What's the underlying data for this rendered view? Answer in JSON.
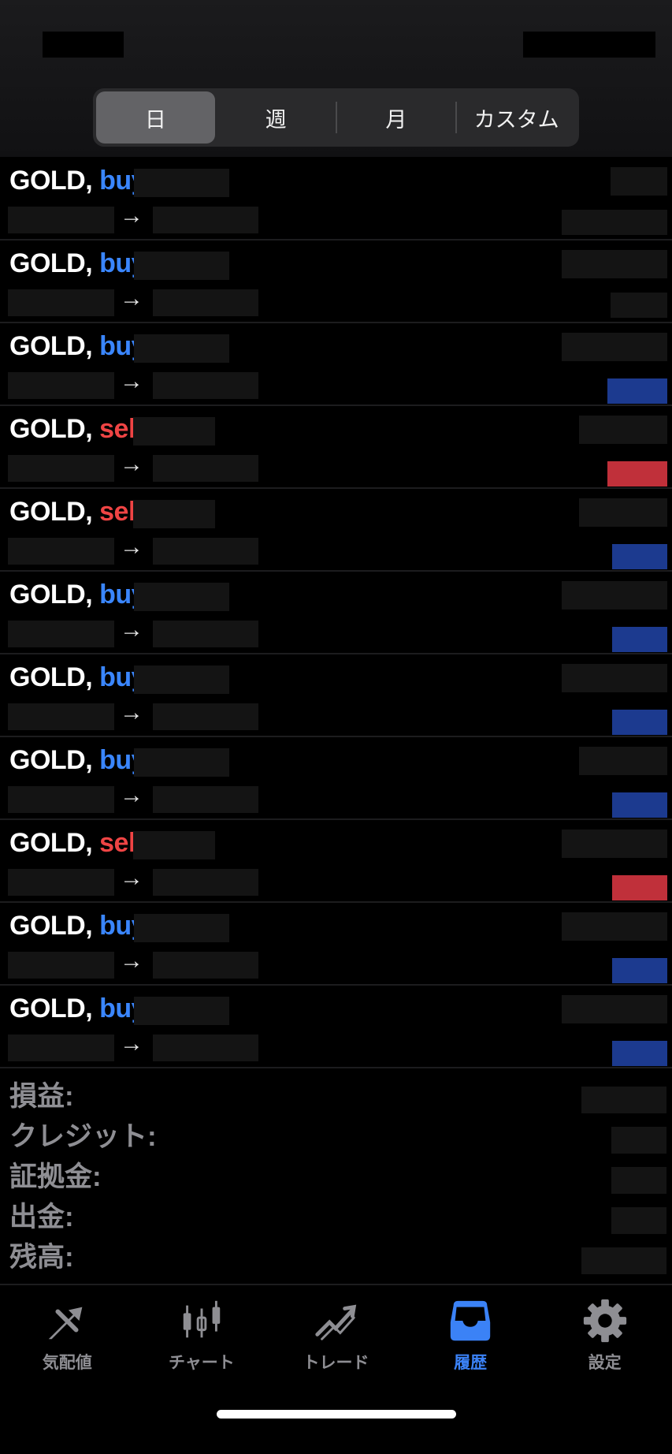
{
  "segments": [
    {
      "label": "日",
      "active": true
    },
    {
      "label": "週",
      "active": false
    },
    {
      "label": "月",
      "active": false
    },
    {
      "label": "カスタム",
      "active": false
    }
  ],
  "symbol": "GOLD,",
  "arrow": "→",
  "colors": {
    "buy": "#3a86ff",
    "sell": "#ef4444",
    "profit": "#1c3a8f",
    "loss": "#c0303a"
  },
  "trades": [
    {
      "side": "buy",
      "result": "none"
    },
    {
      "side": "buy",
      "result": "none"
    },
    {
      "side": "buy",
      "result": "profit"
    },
    {
      "side": "sell",
      "result": "loss"
    },
    {
      "side": "sell",
      "result": "profit"
    },
    {
      "side": "buy",
      "result": "profit"
    },
    {
      "side": "buy",
      "result": "profit"
    },
    {
      "side": "buy",
      "result": "profit"
    },
    {
      "side": "sell",
      "result": "loss"
    },
    {
      "side": "buy",
      "result": "profit"
    },
    {
      "side": "buy",
      "result": "profit"
    }
  ],
  "summary": {
    "pnl": "損益:",
    "credit": "クレジット:",
    "margin": "証拠金:",
    "withdrawal": "出金:",
    "balance": "残高:"
  },
  "tabs": [
    {
      "label": "気配値",
      "icon": "quotes-icon",
      "active": false
    },
    {
      "label": "チャート",
      "icon": "candlestick-icon",
      "active": false
    },
    {
      "label": "トレード",
      "icon": "trade-icon",
      "active": false
    },
    {
      "label": "履歴",
      "icon": "history-inbox-icon",
      "active": true
    },
    {
      "label": "設定",
      "icon": "gear-icon",
      "active": false
    }
  ]
}
